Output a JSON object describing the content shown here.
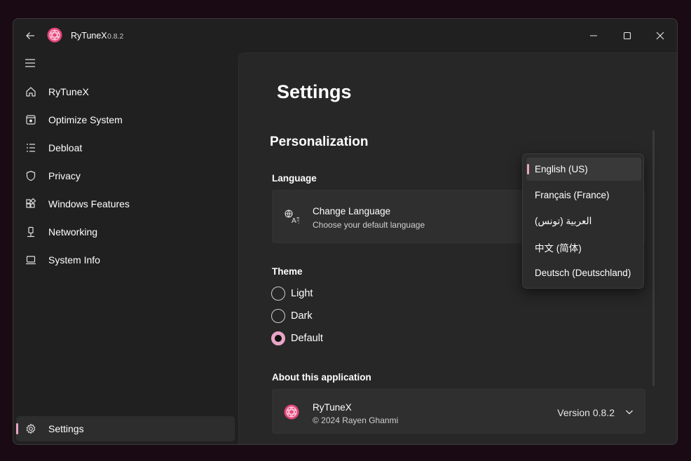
{
  "app": {
    "title": "RyTuneX",
    "version": "0.8.2",
    "accent": "#e9a5c6",
    "logo_color": "#e4457a"
  },
  "titlebar": {
    "back_icon": "arrow-left-icon",
    "minimize_icon": "minimize-icon",
    "maximize_icon": "maximize-icon",
    "close_icon": "close-icon"
  },
  "sidebar": {
    "menu_icon": "hamburger-icon",
    "items": [
      {
        "label": "RyTuneX",
        "icon": "home-icon"
      },
      {
        "label": "Optimize System",
        "icon": "optimize-icon"
      },
      {
        "label": "Debloat",
        "icon": "list-icon"
      },
      {
        "label": "Privacy",
        "icon": "shield-icon"
      },
      {
        "label": "Windows Features",
        "icon": "apps-icon"
      },
      {
        "label": "Networking",
        "icon": "network-icon"
      },
      {
        "label": "System Info",
        "icon": "laptop-icon"
      }
    ],
    "footer": {
      "label": "Settings",
      "icon": "gear-icon",
      "selected": true
    }
  },
  "main": {
    "title": "Settings",
    "section": "Personalization",
    "language": {
      "label": "Language",
      "card_title": "Change Language",
      "card_subtitle": "Choose your default language",
      "options": [
        "English (US)",
        "Français (France)",
        "العربية (تونس)",
        "中文 (简体)",
        "Deutsch (Deutschland)"
      ],
      "selected": "English (US)"
    },
    "theme": {
      "label": "Theme",
      "options": [
        "Light",
        "Dark",
        "Default"
      ],
      "selected": "Default"
    },
    "about": {
      "label": "About this application",
      "name": "RyTuneX",
      "copyright": "© 2024 Rayen Ghanmi",
      "version": "Version 0.8.2"
    }
  }
}
